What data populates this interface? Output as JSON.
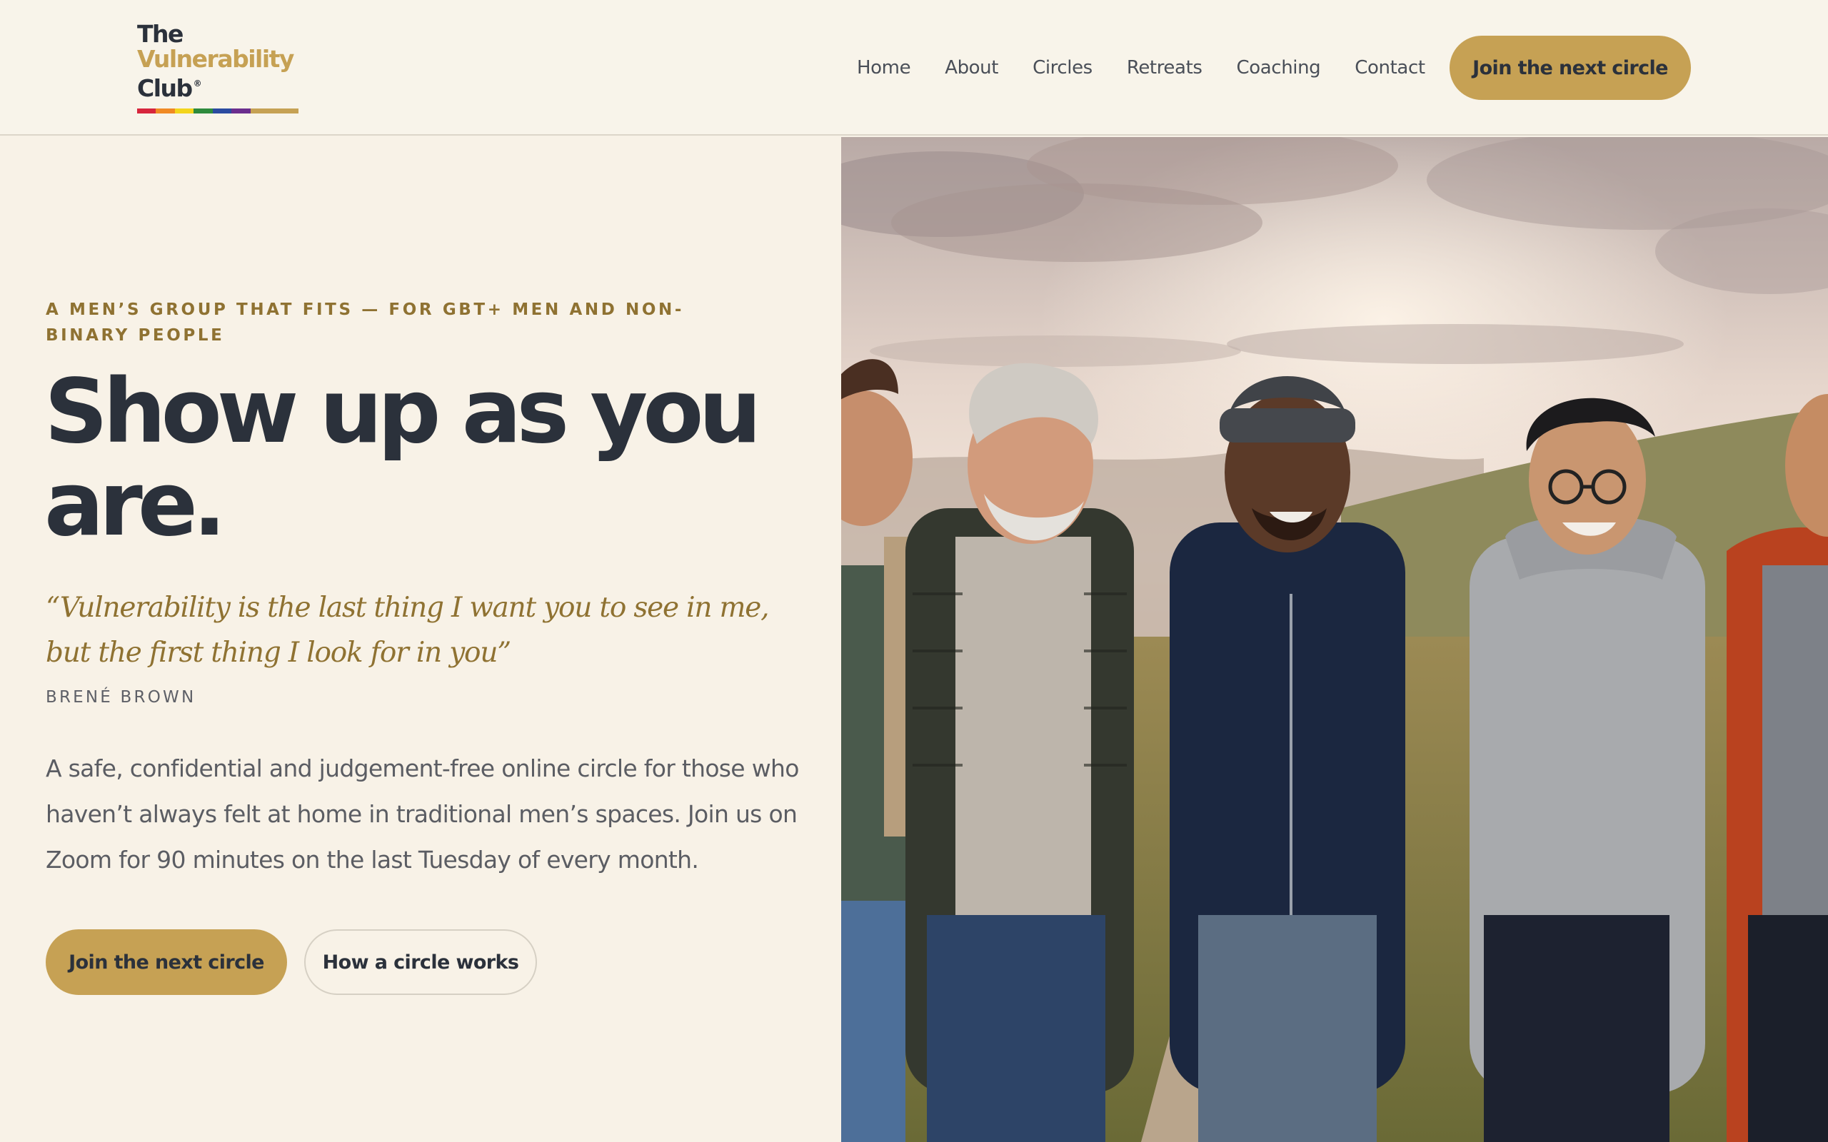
{
  "brand": {
    "line1": "The",
    "line2": "Vulnerability",
    "line3": "Club",
    "registered": "®",
    "pride_colors": [
      "#d7263d",
      "#f08a24",
      "#f3d51c",
      "#2e8b3d",
      "#2b4ba0",
      "#6b2e8e",
      "#c6a154"
    ]
  },
  "nav": {
    "items": [
      "Home",
      "About",
      "Circles",
      "Retreats",
      "Coaching",
      "Contact"
    ],
    "cta_label": "Join the next circle"
  },
  "hero": {
    "eyebrow": "A men’s group that fits — for GBT+ men and non-binary people",
    "headline": "Show up as you are.",
    "quote": "“Vulnerability is the last thing I want you to see in me, but the first thing I look for in you”",
    "quote_author": "Brené Brown",
    "lead": "A safe, confidential and judgement-free online circle for those who haven’t always felt at home in traditional men’s spaces. Join us on Zoom for 90 minutes on the last Tuesday of every month.",
    "primary_cta": "Join the next circle",
    "secondary_cta": "How a circle works"
  },
  "colors": {
    "background": "#f8f2e7",
    "accent_gold": "#c6a154",
    "eyebrow_gold": "#8f7232",
    "ink": "#2b313b",
    "muted_text": "#5b5d63"
  }
}
